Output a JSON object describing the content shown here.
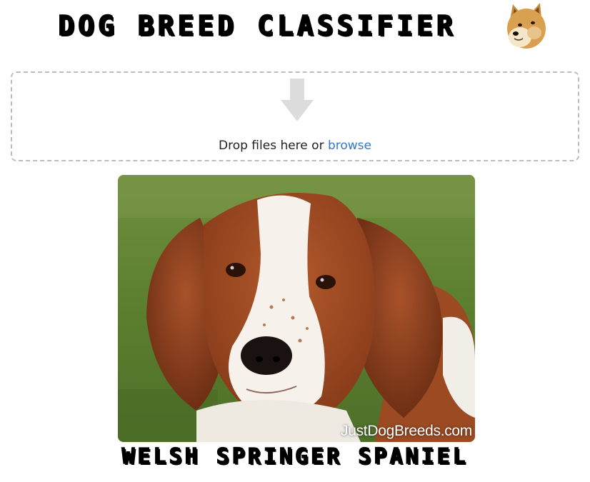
{
  "header": {
    "title": "DOG BREED CLASSIFIER",
    "logo_icon": "doge-icon"
  },
  "dropzone": {
    "icon": "arrow-down-icon",
    "text": "Drop files here or ",
    "browse_label": "browse",
    "link_color": "#3478c6"
  },
  "image": {
    "subject": "welsh-springer-spaniel-photo",
    "watermark": "JustDogBreeds.com"
  },
  "prediction": {
    "label": "WELSH SPRINGER SPANIEL"
  }
}
